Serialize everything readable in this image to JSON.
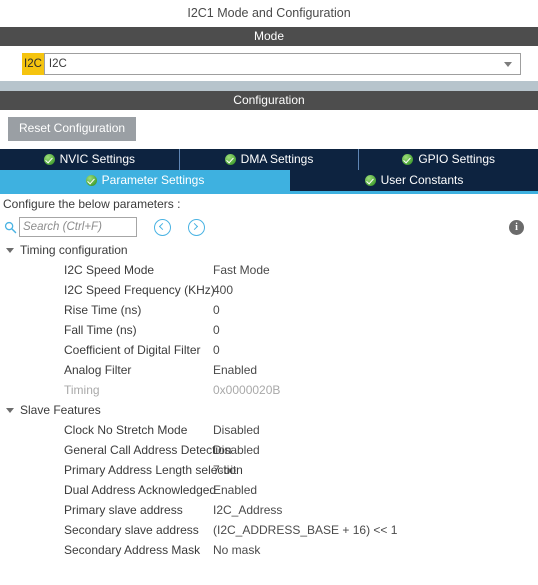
{
  "window": {
    "title": "I2C1 Mode and Configuration"
  },
  "mode": {
    "header": "Mode",
    "badge": "I2C",
    "selected": "I2C",
    "caret_icon": "chevron-down-icon"
  },
  "configuration": {
    "header": "Configuration",
    "reset_label": "Reset Configuration"
  },
  "tabs": {
    "row1": [
      {
        "label": "NVIC Settings",
        "icon": "check-circle-icon",
        "active": false
      },
      {
        "label": "DMA Settings",
        "icon": "check-circle-icon",
        "active": false
      },
      {
        "label": "GPIO Settings",
        "icon": "check-circle-icon",
        "active": false
      }
    ],
    "row2": [
      {
        "label": "Parameter Settings",
        "icon": "check-circle-icon",
        "active": true
      },
      {
        "label": "User Constants",
        "icon": "check-circle-icon",
        "active": false
      }
    ]
  },
  "panel": {
    "caption": "Configure the below parameters :",
    "search": {
      "placeholder": "Search (Ctrl+F)",
      "value": "",
      "icon": "search-icon"
    },
    "prev_icon": "circle-left-arrow-icon",
    "next_icon": "circle-right-arrow-icon",
    "info_icon": "info-icon",
    "info_glyph": "i"
  },
  "groups": [
    {
      "title": "Timing configuration",
      "expanded": true,
      "rows": [
        {
          "label": "I2C Speed Mode",
          "value": "Fast Mode",
          "disabled": false
        },
        {
          "label": "I2C Speed Frequency (KHz)",
          "value": "400",
          "disabled": false
        },
        {
          "label": "Rise Time (ns)",
          "value": "0",
          "disabled": false
        },
        {
          "label": "Fall Time (ns)",
          "value": "0",
          "disabled": false
        },
        {
          "label": "Coefficient of Digital Filter",
          "value": "0",
          "disabled": false
        },
        {
          "label": "Analog Filter",
          "value": "Enabled",
          "disabled": false
        },
        {
          "label": "Timing",
          "value": "0x0000020B",
          "disabled": true
        }
      ]
    },
    {
      "title": "Slave Features",
      "expanded": true,
      "rows": [
        {
          "label": "Clock No Stretch Mode",
          "value": "Disabled",
          "disabled": false
        },
        {
          "label": "General Call Address Detection",
          "value": "Disabled",
          "disabled": false
        },
        {
          "label": "Primary Address Length selection",
          "value": "7-bit",
          "disabled": false
        },
        {
          "label": "Dual Address Acknowledged",
          "value": "Enabled",
          "disabled": false
        },
        {
          "label": "Primary slave address",
          "value": "I2C_Address",
          "disabled": false
        },
        {
          "label": "Secondary slave address",
          "value": "(I2C_ADDRESS_BASE + 16) << 1",
          "disabled": false
        },
        {
          "label": "Secondary Address Mask",
          "value": "No mask",
          "disabled": false
        }
      ]
    }
  ],
  "colors": {
    "header_bar": "#4d4d4d",
    "tab_inactive": "#0d2340",
    "tab_active": "#3eb1e0",
    "badge_yellow": "#f5c40f",
    "divider": "#b7c4cc",
    "check_green": "#4fa83a"
  }
}
